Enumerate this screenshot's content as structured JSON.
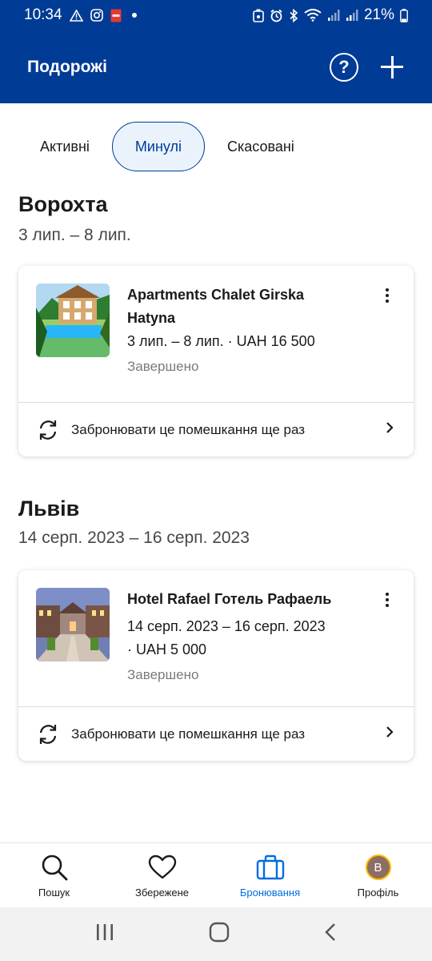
{
  "status_bar": {
    "time": "10:34",
    "battery": "21%"
  },
  "header": {
    "title": "Подорожі",
    "help_icon": "question-circle-icon",
    "add_icon": "plus-icon",
    "help_label": "?"
  },
  "tabs": [
    {
      "label": "Активні",
      "active": false
    },
    {
      "label": "Минулі",
      "active": true
    },
    {
      "label": "Скасовані",
      "active": false
    }
  ],
  "trips": [
    {
      "city": "Ворохта",
      "dates": "3 лип. – 8 лип.",
      "booking": {
        "name_line1": "Apartments Chalet Girska",
        "name_line2": "Hatyna",
        "detail_line1": "3 лип. – 8 лип. · UAH 16 500",
        "detail_line2": "",
        "status": "Завершено",
        "rebook_label": "Забронювати це помешкання ще раз"
      }
    },
    {
      "city": "Львів",
      "dates": "14 серп. 2023 – 16 серп. 2023",
      "booking": {
        "name_line1": "Hotel Rafael Готель Рафаель",
        "name_line2": "",
        "detail_line1": "14 серп. 2023 – 16 серп. 2023",
        "detail_line2": "· UAH 5 000",
        "status": "Завершено",
        "rebook_label": "Забронювати це помешкання ще раз"
      }
    }
  ],
  "bottom_nav": [
    {
      "label": "Пошук",
      "icon": "search-icon",
      "active": false
    },
    {
      "label": "Збережене",
      "icon": "heart-icon",
      "active": false
    },
    {
      "label": "Бронювання",
      "icon": "briefcase-icon",
      "active": true
    },
    {
      "label": "Профіль",
      "icon": "avatar",
      "active": false,
      "avatar_letter": "В"
    }
  ],
  "colors": {
    "brand": "#003b95",
    "active_nav": "#006ce4",
    "avatar_ring": "#febb02"
  }
}
